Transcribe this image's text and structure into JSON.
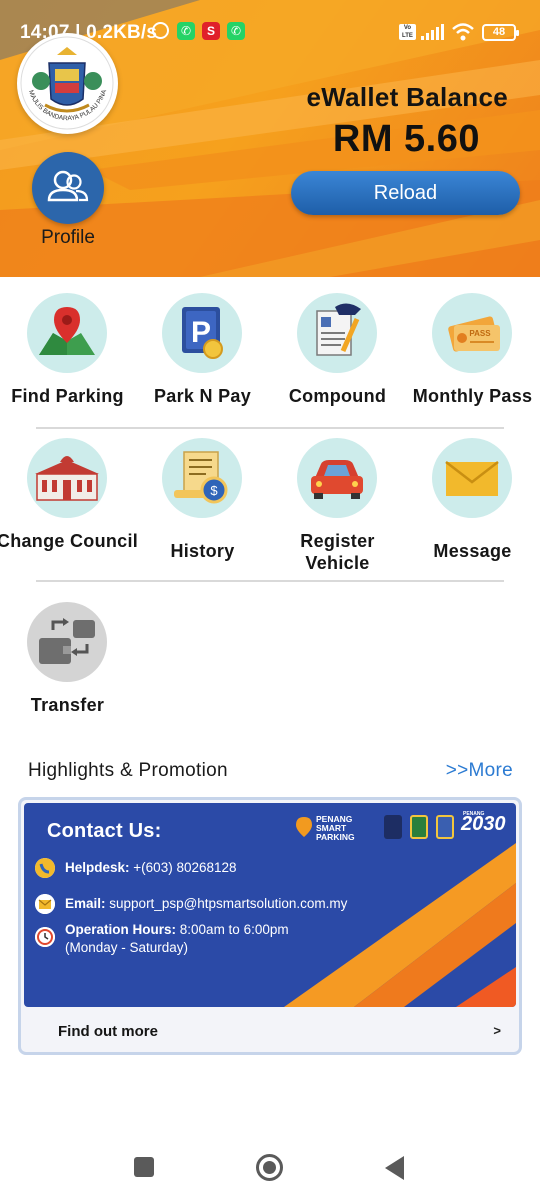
{
  "status_bar": {
    "time": "14:07 | 0.2KB/s",
    "battery": "48",
    "volte": "Vo LTE"
  },
  "header": {
    "logo_text": "MAJLIS BANDARAYA PULAU PINANG",
    "profile_label": "Profile",
    "wallet_title": "eWallet Balance",
    "wallet_amount": "RM 5.60",
    "reload_label": "Reload"
  },
  "menu": [
    {
      "label": "Find Parking",
      "icon": "map-pin-icon"
    },
    {
      "label": "Park N Pay",
      "icon": "parking-sign-icon"
    },
    {
      "label": "Compound",
      "icon": "compound-ticket-icon"
    },
    {
      "label": "Monthly Pass",
      "icon": "pass-ticket-icon"
    },
    {
      "label": "Change Council",
      "icon": "council-building-icon"
    },
    {
      "label": "History",
      "icon": "history-receipt-icon"
    },
    {
      "label": "Register Vehicle",
      "icon": "car-icon"
    },
    {
      "label": "Message",
      "icon": "envelope-icon"
    },
    {
      "label": "Transfer",
      "icon": "wallet-transfer-icon"
    }
  ],
  "highlights": {
    "title": "Highlights & Promotion",
    "more": ">>More"
  },
  "promo_card": {
    "heading": "Contact Us:",
    "helpdesk_label": "Helpdesk:",
    "helpdesk_value": "+(603) 80268128",
    "email_label": "Email:",
    "email_value": "support_psp@htpsmartsolution.com.my",
    "hours_label": "Operation Hours:",
    "hours_value": "8:00am to 6:00pm",
    "hours_days": "(Monday - Saturday)",
    "brand_line1": "PENANG",
    "brand_line2": "SMART",
    "brand_line3": "PARKING",
    "penang_small": "PENANG",
    "penang_year": "2030",
    "cta": "Find out more",
    "cta_arrow": ">"
  },
  "colors": {
    "header_orange": "#f29a1f",
    "reload_blue": "#2c6fc0",
    "icon_circle": "#cdeceb",
    "banner_blue": "#2b4aa7",
    "more_link": "#2c7bd2"
  }
}
